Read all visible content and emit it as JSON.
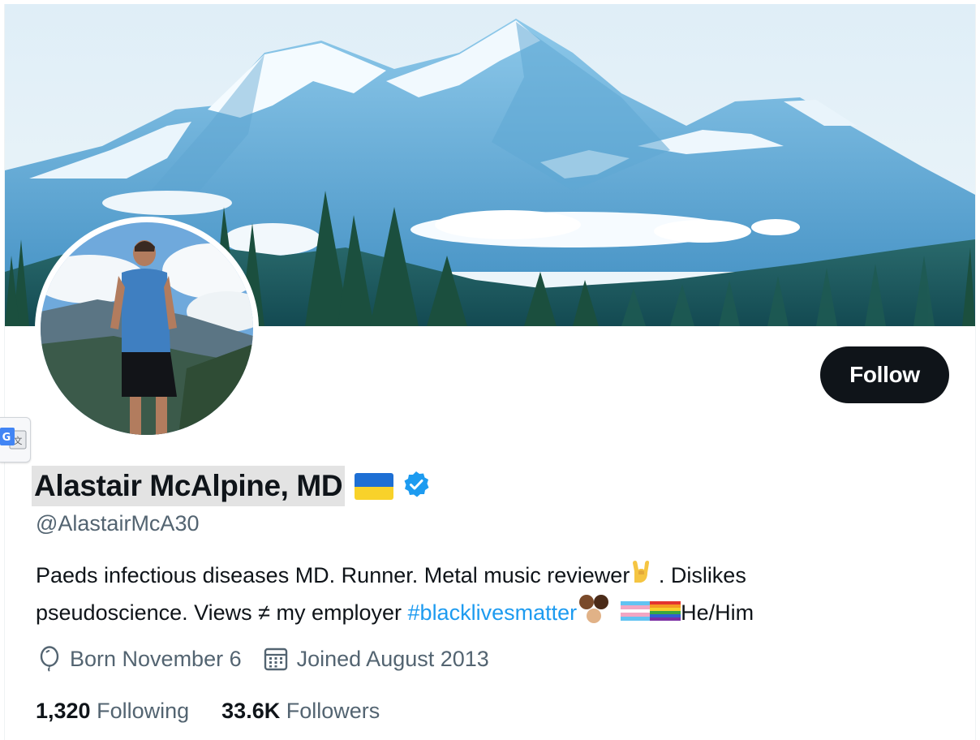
{
  "profile": {
    "display_name": "Alastair McAlpine, MD",
    "handle": "@AlastairMcA30",
    "follow_label": "Follow",
    "bio_line1_text": "Paeds infectious diseases MD. Runner. Metal music reviewer",
    "bio_line1_after_emoji": " . Dislikes",
    "bio_line2_text": "pseudoscience. Views ≠ my employer ",
    "bio_hashtag": "#blacklivesmatter",
    "bio_pronouns": "He/Him",
    "birthday": "Born November 6",
    "joined": "Joined August 2013",
    "following_count": "1,320",
    "following_label": "Following",
    "followers_count": "33.6K",
    "followers_label": "Followers"
  },
  "icons": {
    "flag": "ukraine-flag",
    "verified": "verified-badge-icon",
    "birthday": "balloon-icon",
    "joined": "calendar-icon",
    "translate": "google-translate-icon"
  },
  "colors": {
    "link": "#1d9bf0",
    "secondary_text": "#536471",
    "primary_text": "#0f1419",
    "follow_bg": "#0f1419"
  }
}
